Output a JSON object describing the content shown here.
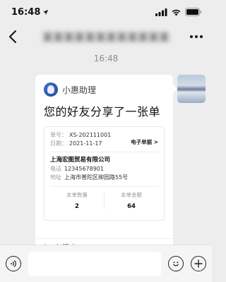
{
  "status_bar": {
    "time": "16:48"
  },
  "header": {
    "chat_name": "某某某某某某某某某某某某"
  },
  "chat": {
    "timestamp": "16:48"
  },
  "message": {
    "app_name": "小惠助理",
    "title": "您的好友分享了一张单",
    "order": {
      "number_label": "单号：",
      "number": "XS-202111001",
      "date_label": "日期：",
      "date": "2021-11-17",
      "receipt_link": "电子单据 >",
      "company": "上海宏图贸易有限公司",
      "phone_label": "电话",
      "phone": "12345678901",
      "address_label": "地址",
      "address": "上海市普陀区柳园路55号",
      "qty_label": "本单数量",
      "qty": "2",
      "amount_label": "本单金额",
      "amount": "64"
    },
    "footer_label": "小程序"
  },
  "colors": {
    "background": "#ededed",
    "card": "#ffffff",
    "accent": "#1e3f8c"
  }
}
